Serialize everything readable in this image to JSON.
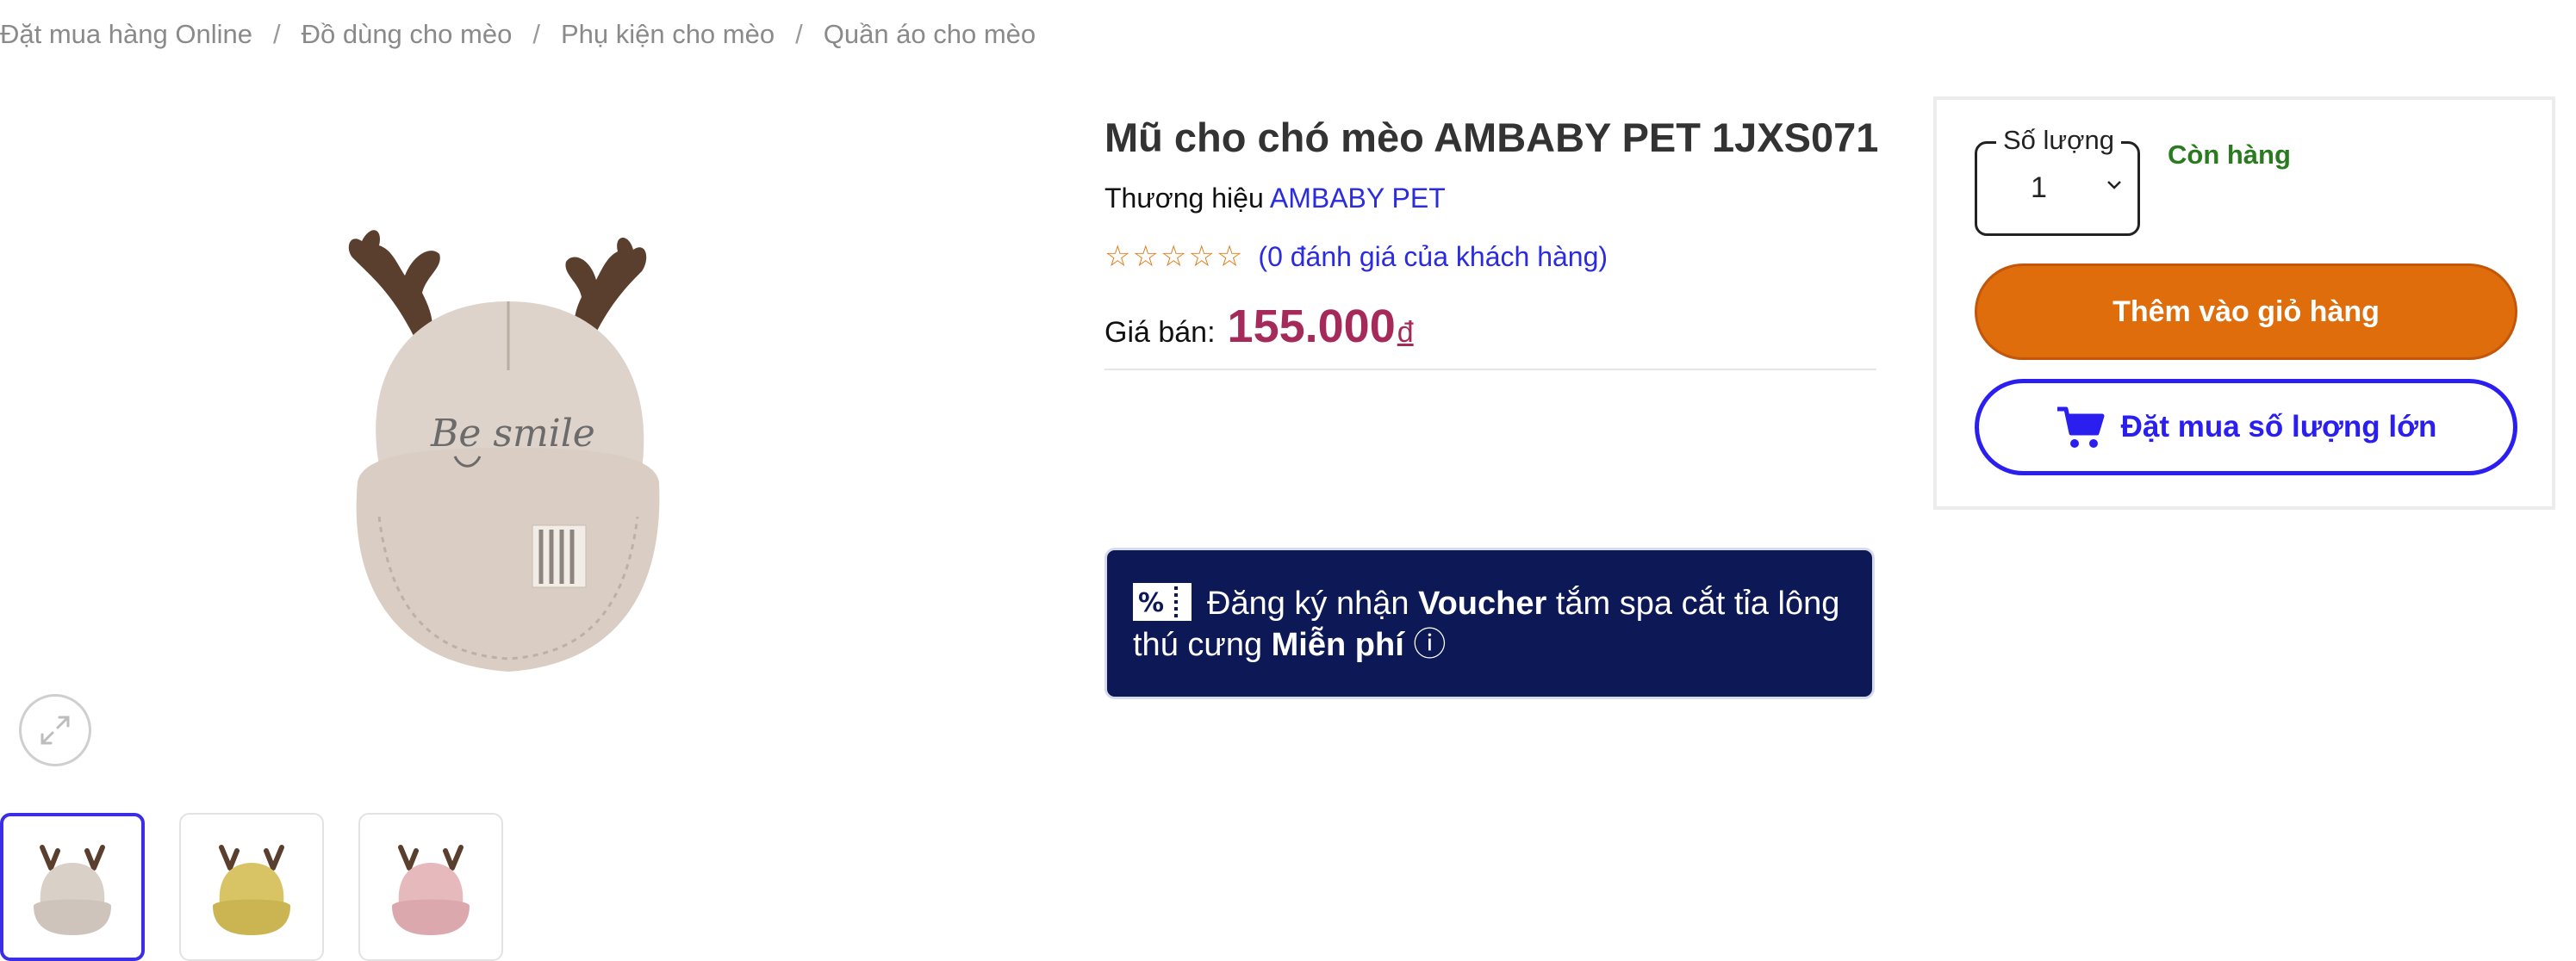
{
  "breadcrumb": [
    "Đặt mua hàng Online",
    "Đồ dùng cho mèo",
    "Phụ kiện cho mèo",
    "Quần áo cho mèo"
  ],
  "breadcrumb_separator": "/",
  "product": {
    "title": "Mũ cho chó mèo AMBABY PET 1JXS071",
    "brand_label": "Thương hiệu",
    "brand_name": "AMBABY PET",
    "stars": "☆☆☆☆☆",
    "rating_text": "(0 đánh giá của khách hàng)",
    "price_label": "Giá bán:",
    "price": "155.000",
    "currency": "đ",
    "hat_text": "Be smile"
  },
  "voucher": {
    "icon": "percent-ticket-icon",
    "text_before": "Đăng ký nhận ",
    "text_bold1": "Voucher",
    "text_middle": " tắm spa cắt tỉa lông thú cưng ",
    "text_bold2": "Miễn phí",
    "info_glyph": " ⓘ"
  },
  "buybox": {
    "qty_label": "Số lượng",
    "qty_value": "1",
    "stock_status": "Còn hàng",
    "add_to_cart": "Thêm vào giỏ hàng",
    "bulk_order": "Đặt mua số lượng lớn"
  },
  "thumbnails": [
    {
      "color": "#d9d0c8"
    },
    {
      "color": "#d8c365"
    },
    {
      "color": "#e6b9bd"
    }
  ],
  "colors": {
    "accent_blue": "#2b1ff0",
    "orange": "#df6d0c",
    "price": "#a52a5a",
    "stock_green": "#2a7a1f",
    "voucher_bg": "#0d1857"
  }
}
